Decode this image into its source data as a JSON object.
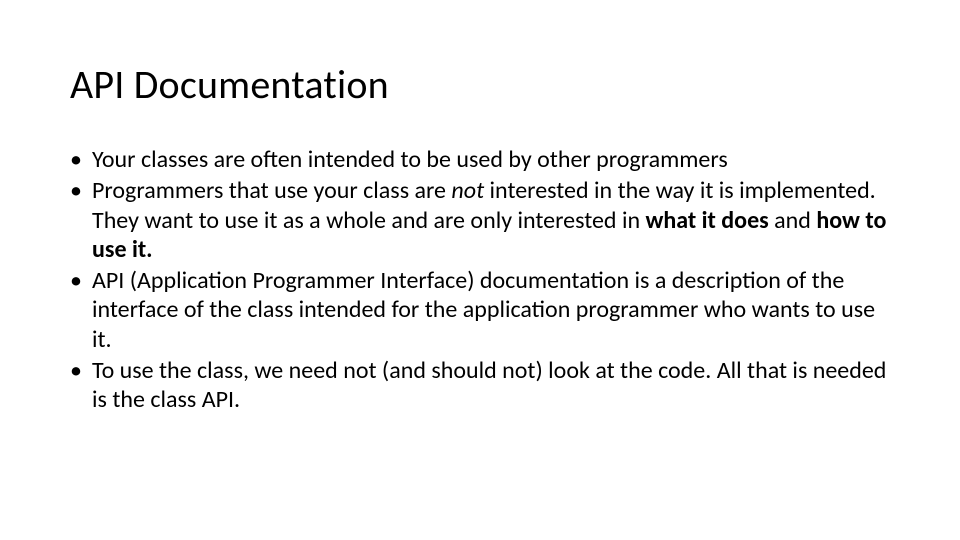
{
  "slide": {
    "title": "API Documentation",
    "bullets": [
      {
        "segments": [
          {
            "text": "Your classes are often intended to be used by other programmers"
          }
        ]
      },
      {
        "segments": [
          {
            "text": "Programmers that use your class are "
          },
          {
            "text": "not",
            "italic": true
          },
          {
            "text": " interested in the way it is implemented. They want to use it as a whole and are only interested in "
          },
          {
            "text": "what it does",
            "bold": true
          },
          {
            "text": " and "
          },
          {
            "text": "how to use it.",
            "bold": true
          }
        ]
      },
      {
        "segments": [
          {
            "text": "API (Application Programmer Interface) documentation is a description of the interface of the class intended for the application programmer who wants to use it."
          }
        ]
      },
      {
        "segments": [
          {
            "text": "To use the class, we need not (and should not) look at the code. All that is needed is the class API."
          }
        ]
      }
    ]
  }
}
